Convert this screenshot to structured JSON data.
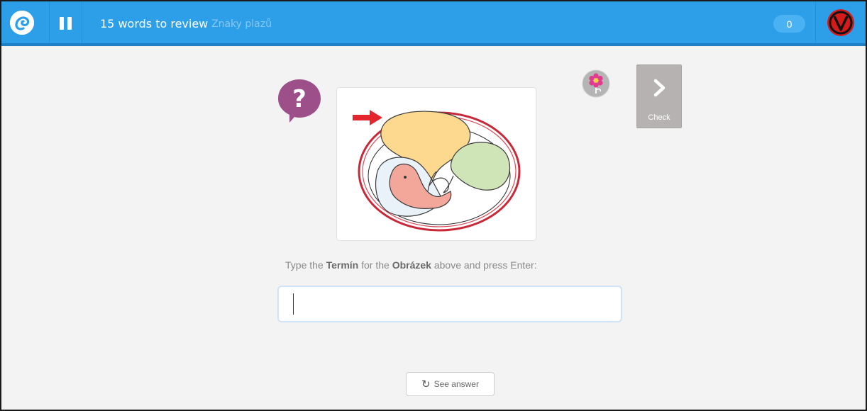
{
  "header": {
    "title": "15 words to review",
    "subtitle": "Znaky plazů",
    "score": "0",
    "icons": [
      "app-logo-icon",
      "pause-icon",
      "user-avatar-icon"
    ],
    "colors": {
      "bar": "#2d9ee8",
      "bar_border": "#1f7fc4",
      "pill": "#4ab2f3"
    }
  },
  "question": {
    "icon": "question-bubble-icon",
    "image_icon": "embryo-in-egg-image",
    "prompt_pre": "Type the ",
    "prompt_term": "Termín",
    "prompt_mid": " for the ",
    "prompt_obj": "Obrázek",
    "prompt_post": " above and press Enter:"
  },
  "input": {
    "value": "",
    "placeholder": ""
  },
  "actions": {
    "check_label": "Check",
    "see_answer_label": "See answer",
    "flower_icon": "flower-icon",
    "refresh_icon": "refresh-icon"
  }
}
